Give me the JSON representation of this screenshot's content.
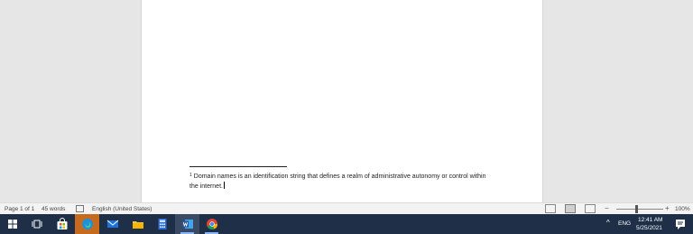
{
  "document": {
    "footnote_number": "1",
    "footnote_text": "Domain names is an identification string that defines a realm of administrative autonomy or control within the internet."
  },
  "statusbar": {
    "page": "Page 1 of 1",
    "words": "45 words",
    "language": "English (United States)",
    "zoom_minus": "−",
    "zoom_plus": "+",
    "zoom": "100%",
    "zoom_level_percent": 100
  },
  "taskbar": {
    "apps": [
      {
        "name": "task-view",
        "icon": "task-view-icon"
      },
      {
        "name": "microsoft-store",
        "icon": "store-icon"
      },
      {
        "name": "microsoft-edge",
        "icon": "edge-icon"
      },
      {
        "name": "mail",
        "icon": "mail-icon"
      },
      {
        "name": "file-explorer",
        "icon": "folder-icon"
      },
      {
        "name": "calculator",
        "icon": "calculator-icon"
      },
      {
        "name": "microsoft-word",
        "icon": "word-icon"
      },
      {
        "name": "google-chrome",
        "icon": "chrome-icon"
      }
    ],
    "tray_chevron": "^",
    "language": "ENG",
    "time": "12:41 AM",
    "date": "5/25/2021"
  },
  "colors": {
    "taskbar": "#1f2f47",
    "edge": "#1f8fe0",
    "word": "#2b579a",
    "store_accent": "#f5a623"
  }
}
